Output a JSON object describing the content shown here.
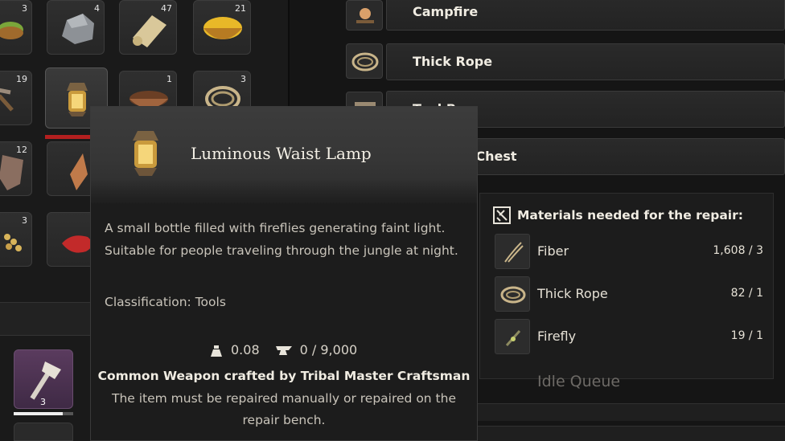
{
  "inventory": {
    "slots": [
      {
        "name": "herb",
        "count": "3"
      },
      {
        "name": "stone",
        "count": "4"
      },
      {
        "name": "parchment",
        "count": "47"
      },
      {
        "name": "broth-bowl",
        "count": "21"
      },
      {
        "name": "pickaxe",
        "count": "19"
      },
      {
        "name": "lamp",
        "count": ""
      },
      {
        "name": "wooden-bowl",
        "count": "1"
      },
      {
        "name": "rope",
        "count": "3"
      },
      {
        "name": "hide",
        "count": "12"
      },
      {
        "name": "stone-shard",
        "count": ""
      },
      {
        "name": "seeds",
        "count": "3"
      },
      {
        "name": "raw-meat",
        "count": ""
      }
    ],
    "weapon": {
      "count": "3",
      "durability": 0.82
    }
  },
  "recipes": [
    {
      "label": "Campfire",
      "icon": "campfire-icon"
    },
    {
      "label": "Thick Rope",
      "icon": "rope-icon"
    },
    {
      "label": "Tool Box",
      "icon": "toolbox-icon"
    },
    {
      "label": "Wooden Chest",
      "icon": "chest-icon"
    }
  ],
  "tooltip": {
    "title": "Luminous Waist Lamp",
    "description": "A small bottle filled with fireflies generating faint light. Suitable for people traveling through the jungle at night.",
    "classification": "Classification: Tools",
    "weight": "0.08",
    "durability": "0 / 9,000",
    "crafted_by": "Common Weapon crafted by Tribal Master Craftsman",
    "repair_note": "The item must be repaired manually or repaired on the repair bench."
  },
  "materials": {
    "title": "Materials needed for the repair:",
    "items": [
      {
        "name": "Fiber",
        "count": "1,608 / 3"
      },
      {
        "name": "Thick Rope",
        "count": "82 / 1"
      },
      {
        "name": "Firefly",
        "count": "19 / 1"
      }
    ]
  },
  "queue": {
    "label": "Idle Queue"
  }
}
